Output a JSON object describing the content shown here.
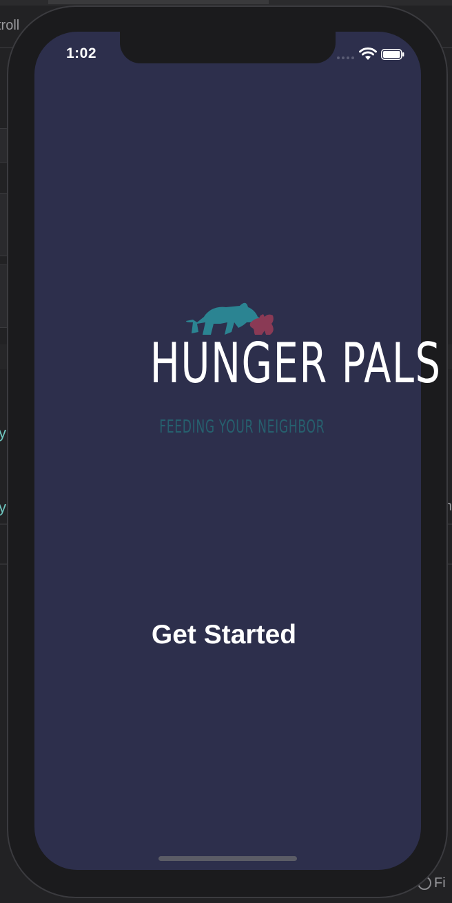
{
  "background": {
    "cut_text": "troll",
    "side_text_1": "y",
    "side_text_2": "y",
    "right_text": "n",
    "filter_label": "Fi"
  },
  "status_bar": {
    "time": "1:02",
    "wifi_icon": "wifi-icon",
    "battery_icon": "battery-icon"
  },
  "splash": {
    "logo_icon": "bear-and-cub-icon",
    "brand_name": "HUNGER PALS",
    "tagline": "FEEDING YOUR NEIGHBOR",
    "colors": {
      "screen_bg": "#2d2f4c",
      "bear": "#2b8492",
      "cub": "#8a3a55",
      "tagline": "#26606e"
    }
  },
  "cta": {
    "label": "Get Started"
  }
}
